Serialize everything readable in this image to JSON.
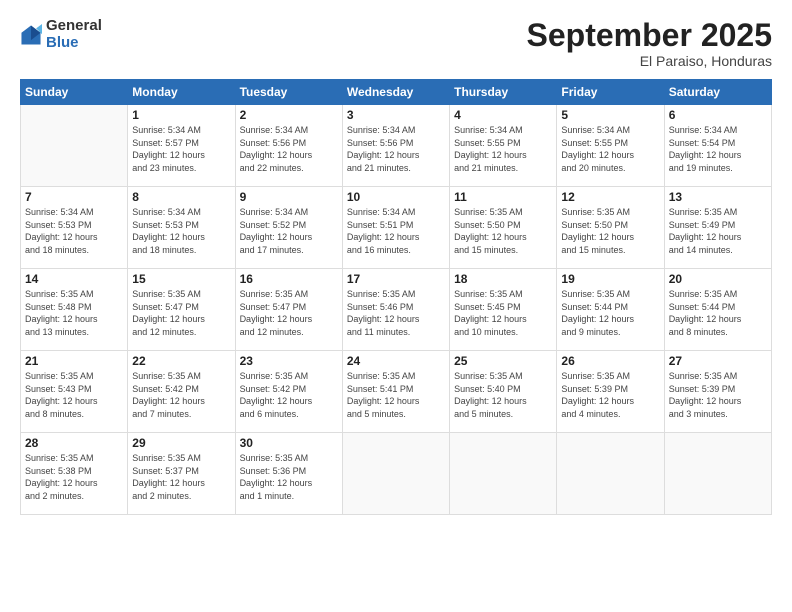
{
  "logo": {
    "general": "General",
    "blue": "Blue"
  },
  "header": {
    "month": "September 2025",
    "location": "El Paraiso, Honduras"
  },
  "weekdays": [
    "Sunday",
    "Monday",
    "Tuesday",
    "Wednesday",
    "Thursday",
    "Friday",
    "Saturday"
  ],
  "days": [
    {
      "num": "",
      "info": ""
    },
    {
      "num": "1",
      "info": "Sunrise: 5:34 AM\nSunset: 5:57 PM\nDaylight: 12 hours\nand 23 minutes."
    },
    {
      "num": "2",
      "info": "Sunrise: 5:34 AM\nSunset: 5:56 PM\nDaylight: 12 hours\nand 22 minutes."
    },
    {
      "num": "3",
      "info": "Sunrise: 5:34 AM\nSunset: 5:56 PM\nDaylight: 12 hours\nand 21 minutes."
    },
    {
      "num": "4",
      "info": "Sunrise: 5:34 AM\nSunset: 5:55 PM\nDaylight: 12 hours\nand 21 minutes."
    },
    {
      "num": "5",
      "info": "Sunrise: 5:34 AM\nSunset: 5:55 PM\nDaylight: 12 hours\nand 20 minutes."
    },
    {
      "num": "6",
      "info": "Sunrise: 5:34 AM\nSunset: 5:54 PM\nDaylight: 12 hours\nand 19 minutes."
    },
    {
      "num": "7",
      "info": "Sunrise: 5:34 AM\nSunset: 5:53 PM\nDaylight: 12 hours\nand 18 minutes."
    },
    {
      "num": "8",
      "info": "Sunrise: 5:34 AM\nSunset: 5:53 PM\nDaylight: 12 hours\nand 18 minutes."
    },
    {
      "num": "9",
      "info": "Sunrise: 5:34 AM\nSunset: 5:52 PM\nDaylight: 12 hours\nand 17 minutes."
    },
    {
      "num": "10",
      "info": "Sunrise: 5:34 AM\nSunset: 5:51 PM\nDaylight: 12 hours\nand 16 minutes."
    },
    {
      "num": "11",
      "info": "Sunrise: 5:35 AM\nSunset: 5:50 PM\nDaylight: 12 hours\nand 15 minutes."
    },
    {
      "num": "12",
      "info": "Sunrise: 5:35 AM\nSunset: 5:50 PM\nDaylight: 12 hours\nand 15 minutes."
    },
    {
      "num": "13",
      "info": "Sunrise: 5:35 AM\nSunset: 5:49 PM\nDaylight: 12 hours\nand 14 minutes."
    },
    {
      "num": "14",
      "info": "Sunrise: 5:35 AM\nSunset: 5:48 PM\nDaylight: 12 hours\nand 13 minutes."
    },
    {
      "num": "15",
      "info": "Sunrise: 5:35 AM\nSunset: 5:47 PM\nDaylight: 12 hours\nand 12 minutes."
    },
    {
      "num": "16",
      "info": "Sunrise: 5:35 AM\nSunset: 5:47 PM\nDaylight: 12 hours\nand 12 minutes."
    },
    {
      "num": "17",
      "info": "Sunrise: 5:35 AM\nSunset: 5:46 PM\nDaylight: 12 hours\nand 11 minutes."
    },
    {
      "num": "18",
      "info": "Sunrise: 5:35 AM\nSunset: 5:45 PM\nDaylight: 12 hours\nand 10 minutes."
    },
    {
      "num": "19",
      "info": "Sunrise: 5:35 AM\nSunset: 5:44 PM\nDaylight: 12 hours\nand 9 minutes."
    },
    {
      "num": "20",
      "info": "Sunrise: 5:35 AM\nSunset: 5:44 PM\nDaylight: 12 hours\nand 8 minutes."
    },
    {
      "num": "21",
      "info": "Sunrise: 5:35 AM\nSunset: 5:43 PM\nDaylight: 12 hours\nand 8 minutes."
    },
    {
      "num": "22",
      "info": "Sunrise: 5:35 AM\nSunset: 5:42 PM\nDaylight: 12 hours\nand 7 minutes."
    },
    {
      "num": "23",
      "info": "Sunrise: 5:35 AM\nSunset: 5:42 PM\nDaylight: 12 hours\nand 6 minutes."
    },
    {
      "num": "24",
      "info": "Sunrise: 5:35 AM\nSunset: 5:41 PM\nDaylight: 12 hours\nand 5 minutes."
    },
    {
      "num": "25",
      "info": "Sunrise: 5:35 AM\nSunset: 5:40 PM\nDaylight: 12 hours\nand 5 minutes."
    },
    {
      "num": "26",
      "info": "Sunrise: 5:35 AM\nSunset: 5:39 PM\nDaylight: 12 hours\nand 4 minutes."
    },
    {
      "num": "27",
      "info": "Sunrise: 5:35 AM\nSunset: 5:39 PM\nDaylight: 12 hours\nand 3 minutes."
    },
    {
      "num": "28",
      "info": "Sunrise: 5:35 AM\nSunset: 5:38 PM\nDaylight: 12 hours\nand 2 minutes."
    },
    {
      "num": "29",
      "info": "Sunrise: 5:35 AM\nSunset: 5:37 PM\nDaylight: 12 hours\nand 2 minutes."
    },
    {
      "num": "30",
      "info": "Sunrise: 5:35 AM\nSunset: 5:36 PM\nDaylight: 12 hours\nand 1 minute."
    },
    {
      "num": "",
      "info": ""
    },
    {
      "num": "",
      "info": ""
    },
    {
      "num": "",
      "info": ""
    },
    {
      "num": "",
      "info": ""
    }
  ]
}
